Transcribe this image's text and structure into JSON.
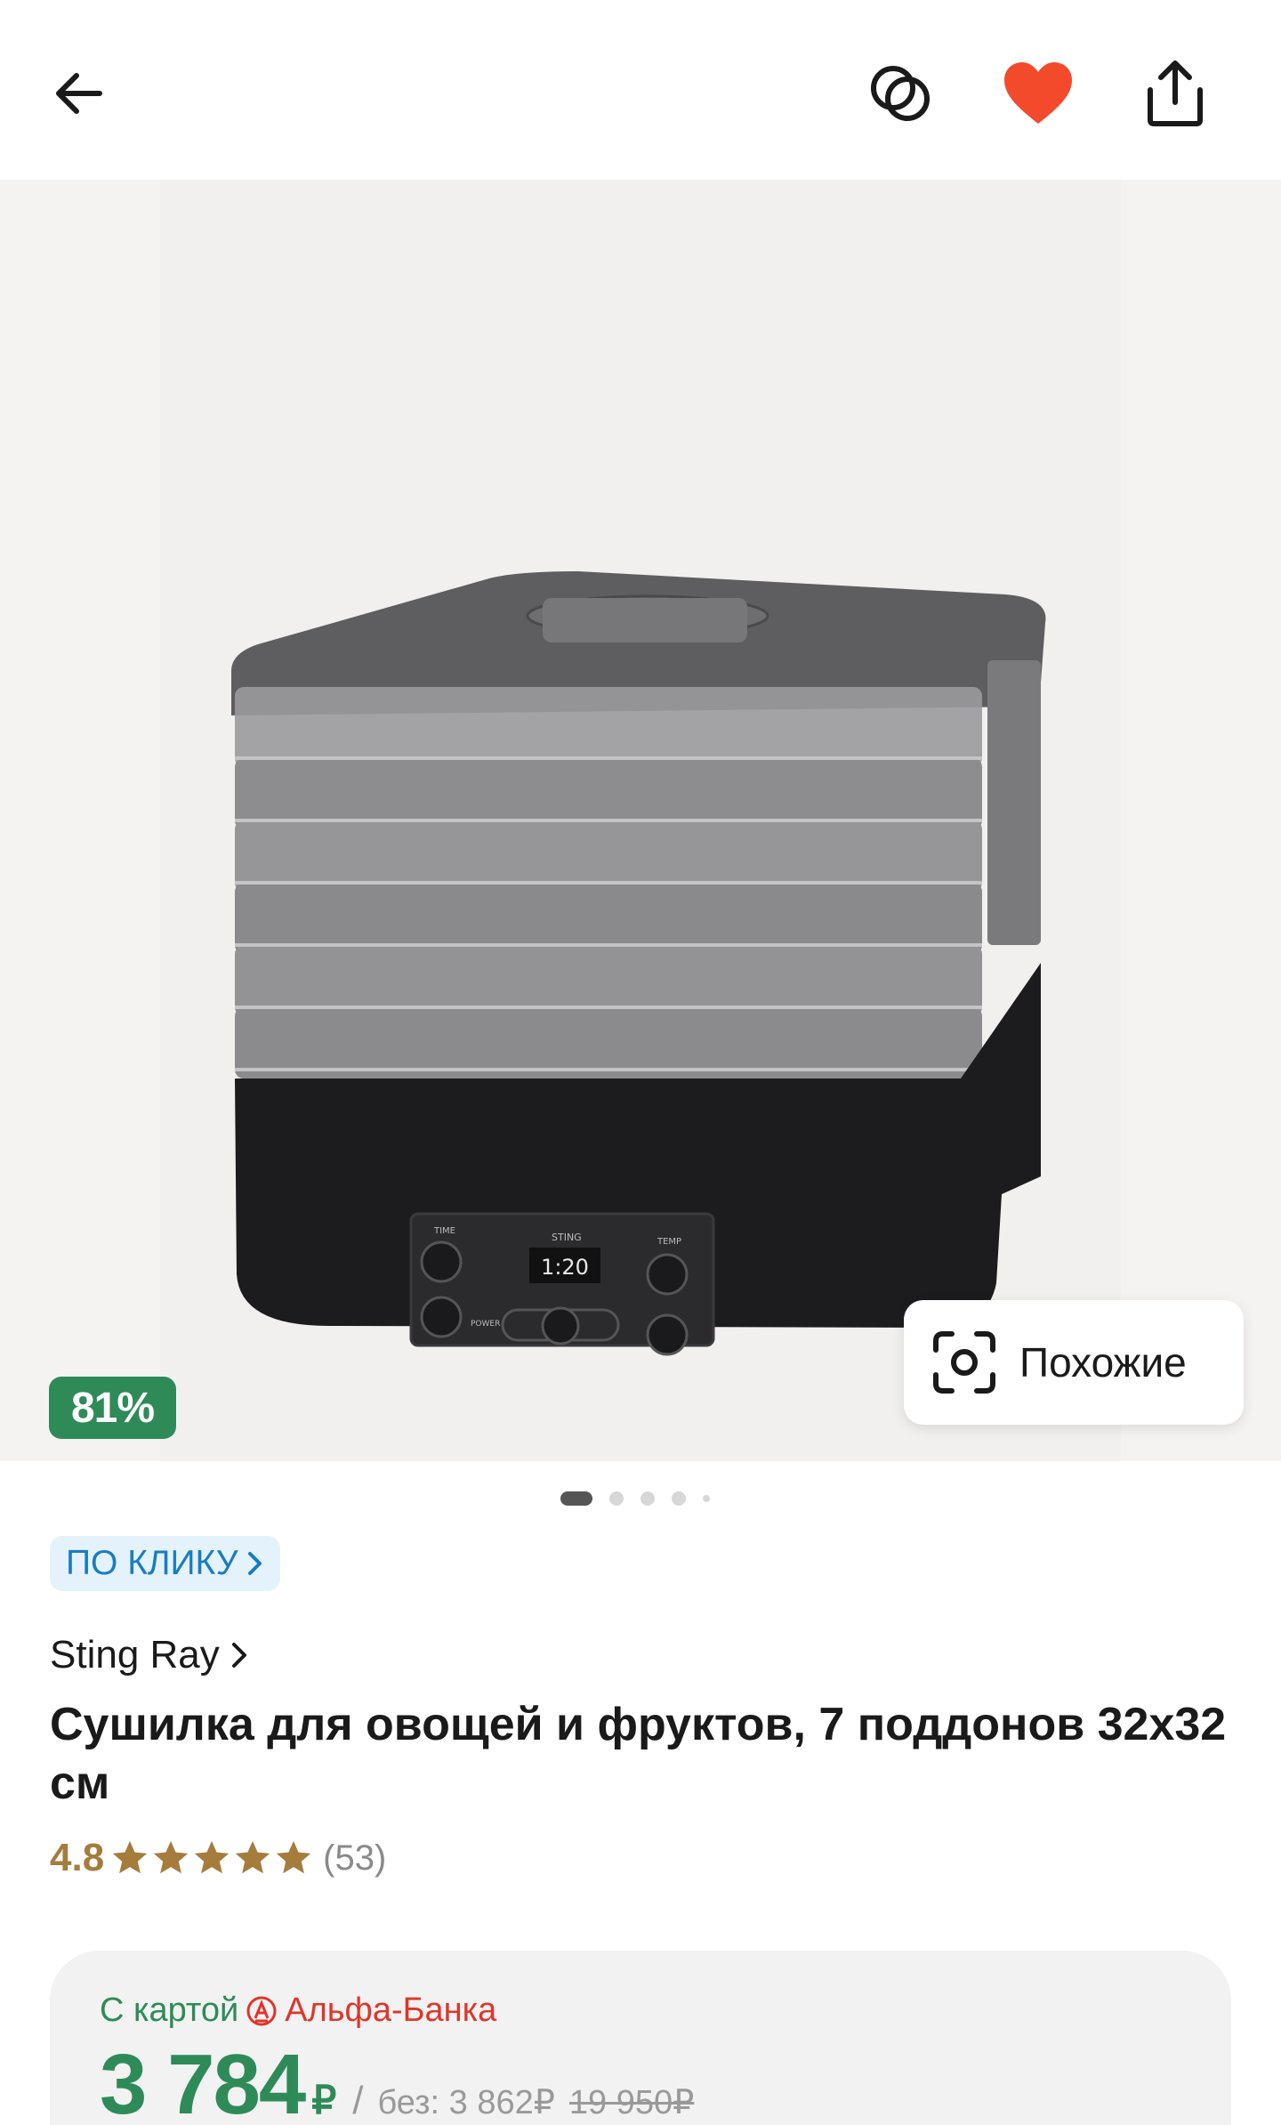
{
  "header": {
    "back_icon": "arrow-left-icon",
    "compare_icon": "compare-circles-icon",
    "favorite_icon": "heart-filled-icon",
    "share_icon": "share-icon",
    "favorite_color": "#f24a2b"
  },
  "gallery": {
    "discount_badge": "81%",
    "similar_label": "Похожие",
    "similar_icon": "camera-scan-icon",
    "image_display": "1:20",
    "image_brand": "STING",
    "image_labels": [
      "TIME",
      "TEMP",
      "POWER"
    ],
    "dots_total": 5,
    "active_dot": 1
  },
  "product": {
    "promo_label": "ПО КЛИКУ",
    "brand": "Sting Ray",
    "title": "Сушилка для овощей и фруктов, 7 поддонов 32х32 см",
    "rating": "4.8",
    "rating_count": "(53)",
    "stars": 5
  },
  "price": {
    "card_prefix": "С картой",
    "bank_name": "Альфа-Банка",
    "current": "3 784",
    "currency": "₽",
    "separator": "/",
    "without_card": "без: 3 862₽",
    "old_price": "19 950₽"
  },
  "colors": {
    "green": "#2e8b57",
    "rating_gold": "#a67c3d",
    "promo_blue": "#1a7cc2",
    "alfa_red": "#e0352a"
  }
}
